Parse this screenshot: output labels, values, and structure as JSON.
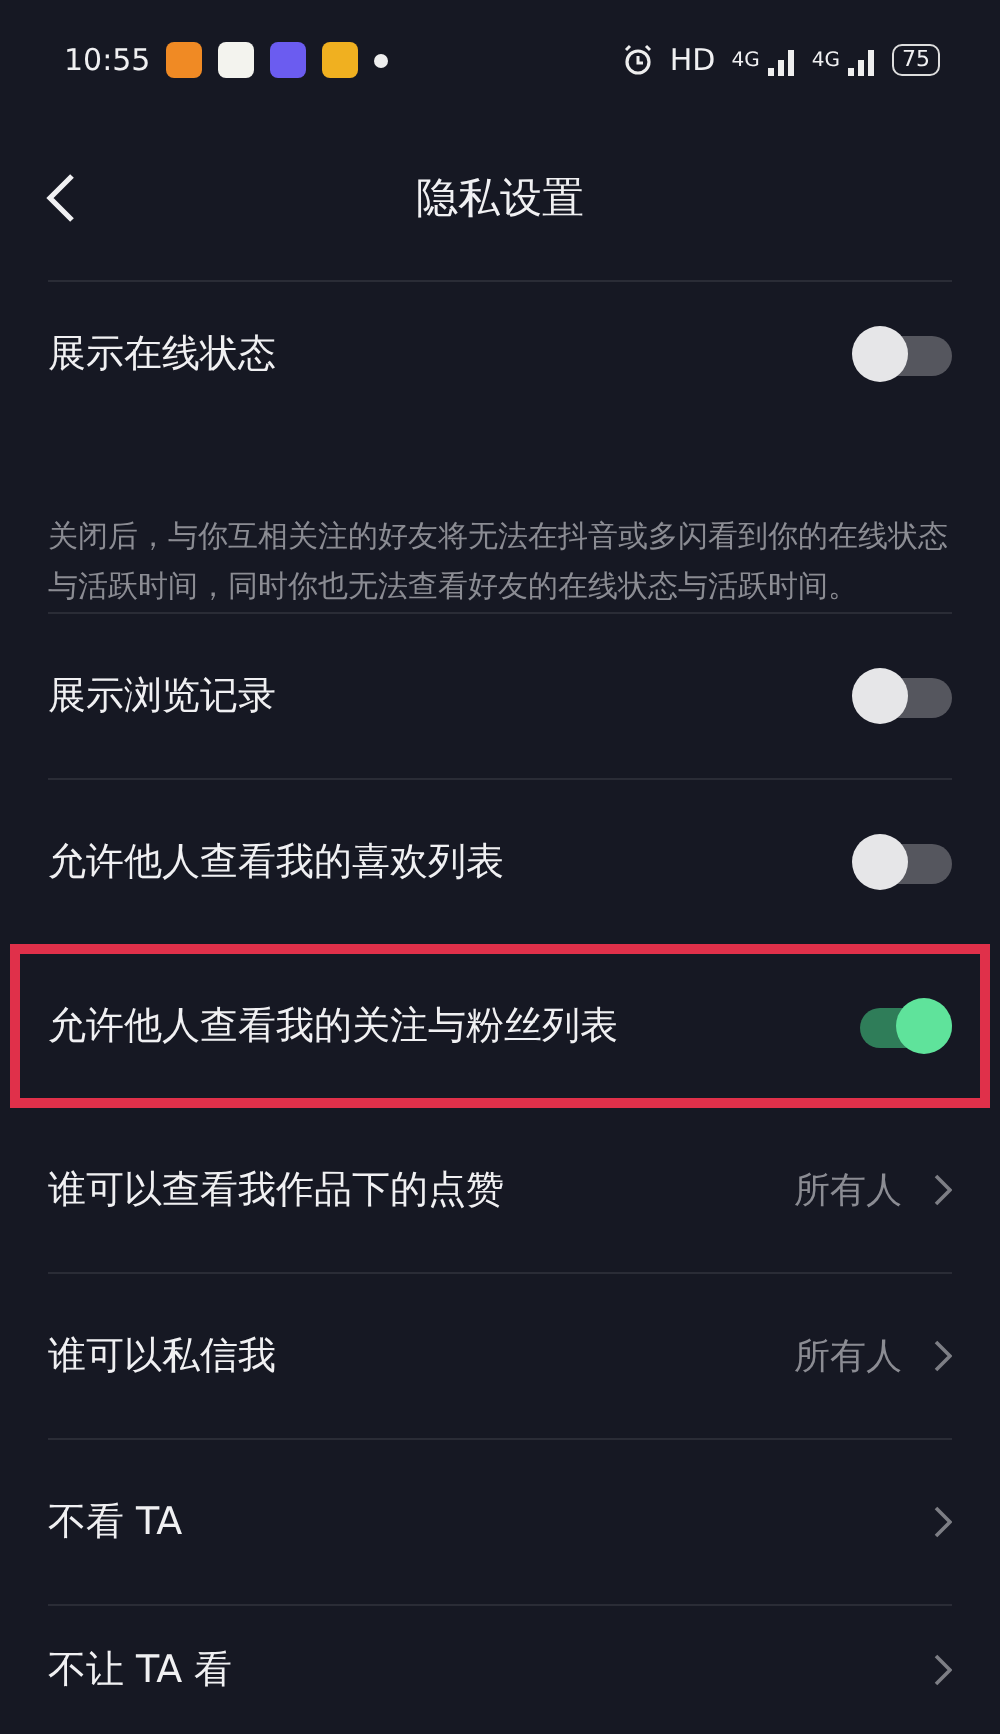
{
  "status_bar": {
    "time": "10:55",
    "hd": "HD",
    "networks": [
      "4G",
      "4G"
    ],
    "battery": "75"
  },
  "header": {
    "title": "隐私设置"
  },
  "settings": [
    {
      "kind": "toggle",
      "label": "展示在线状态",
      "description": "关闭后，与你互相关注的好友将无法在抖音或多闪看到你的在线状态与活跃时间，同时你也无法查看好友的在线状态与活跃时间。",
      "on": false,
      "highlighted": false
    },
    {
      "kind": "toggle",
      "label": "展示浏览记录",
      "on": false,
      "highlighted": false
    },
    {
      "kind": "toggle",
      "label": "允许他人查看我的喜欢列表",
      "on": false,
      "highlighted": false
    },
    {
      "kind": "toggle",
      "label": "允许他人查看我的关注与粉丝列表",
      "on": true,
      "highlighted": true
    },
    {
      "kind": "link",
      "label": "谁可以查看我作品下的点赞",
      "value": "所有人",
      "highlighted": false
    },
    {
      "kind": "link",
      "label": "谁可以私信我",
      "value": "所有人",
      "highlighted": false
    },
    {
      "kind": "link",
      "label": "不看 TA",
      "highlighted": false
    },
    {
      "kind": "link",
      "label": "不让 TA 看",
      "highlighted": false
    }
  ]
}
